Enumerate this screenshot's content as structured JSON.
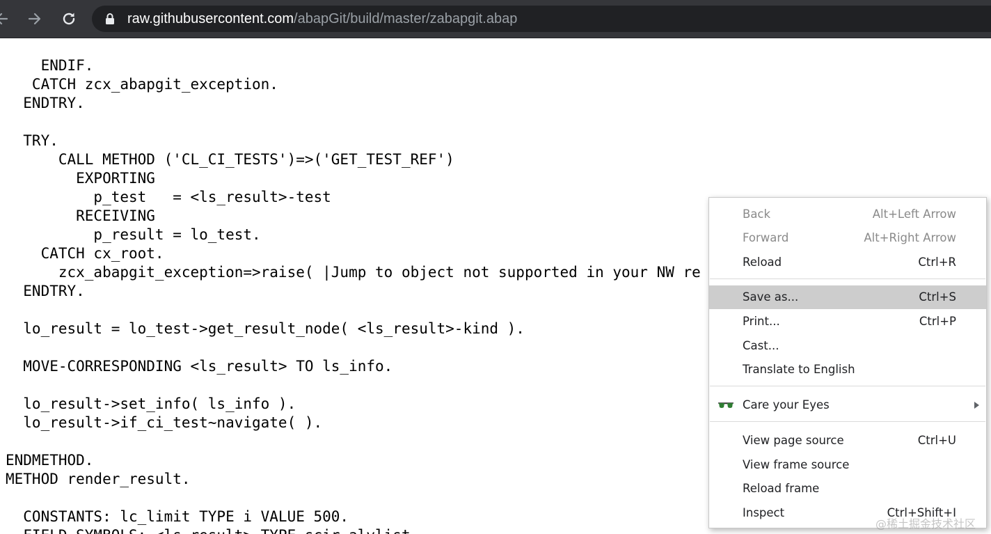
{
  "browser": {
    "url_host": "raw.githubusercontent.com",
    "url_path": "/abapGit/build/master/zabapgit.abap"
  },
  "code_lines": [
    "    ENDIF.",
    "   CATCH zcx_abapgit_exception.",
    "  ENDTRY.",
    "",
    "  TRY.",
    "      CALL METHOD ('CL_CI_TESTS')=>('GET_TEST_REF')",
    "        EXPORTING",
    "          p_test   = <ls_result>-test",
    "        RECEIVING",
    "          p_result = lo_test.",
    "    CATCH cx_root.",
    "      zcx_abapgit_exception=>raise( |Jump to object not supported in your NW re",
    "  ENDTRY.",
    "",
    "  lo_result = lo_test->get_result_node( <ls_result>-kind ).",
    "",
    "  MOVE-CORRESPONDING <ls_result> TO ls_info.",
    "",
    "  lo_result->set_info( ls_info ).",
    "  lo_result->if_ci_test~navigate( ).",
    "",
    "ENDMETHOD.",
    "METHOD render_result.",
    "",
    "  CONSTANTS: lc_limit TYPE i VALUE 500.",
    "  FIELD-SYMBOLS: <ls_result> TYPE scir_alvlist."
  ],
  "context_menu": {
    "items": [
      {
        "label": "Back",
        "shortcut": "Alt+Left Arrow"
      },
      {
        "label": "Forward",
        "shortcut": "Alt+Right Arrow"
      },
      {
        "label": "Reload",
        "shortcut": "Ctrl+R"
      },
      {
        "label": "Save as...",
        "shortcut": "Ctrl+S"
      },
      {
        "label": "Print...",
        "shortcut": "Ctrl+P"
      },
      {
        "label": "Cast...",
        "shortcut": ""
      },
      {
        "label": "Translate to English",
        "shortcut": ""
      },
      {
        "label": "Care your Eyes",
        "shortcut": "",
        "icon": "glasses-icon"
      },
      {
        "label": "View page source",
        "shortcut": "Ctrl+U"
      },
      {
        "label": "View frame source",
        "shortcut": ""
      },
      {
        "label": "Reload frame",
        "shortcut": ""
      },
      {
        "label": "Inspect",
        "shortcut": "Ctrl+Shift+I"
      }
    ],
    "highlighted_item": "Save as...",
    "disabled_items": [
      "Back",
      "Forward"
    ]
  },
  "watermark": "@稀土掘金技术社区",
  "colors": {
    "toolbar_bg": "#35363a",
    "omnibox_bg": "#202124",
    "highlight_bg": "#cdcdcd",
    "icon_color": "#e8eaed",
    "glasses_lens": "#2e7d32"
  }
}
